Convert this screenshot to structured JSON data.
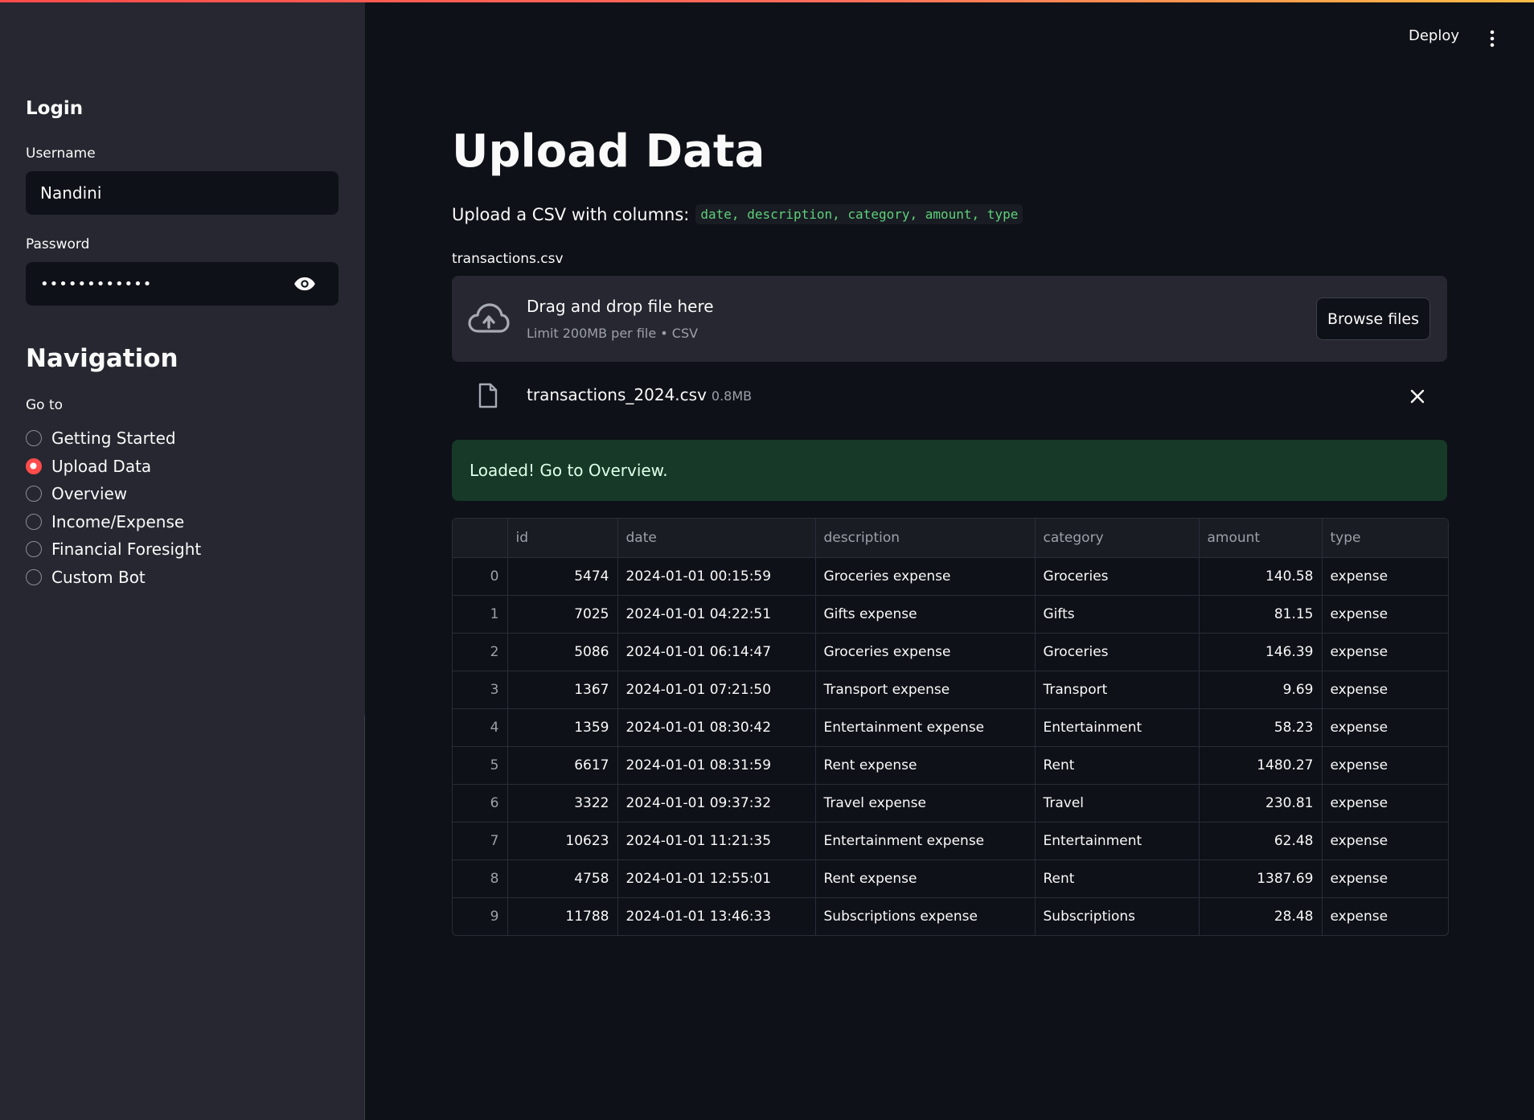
{
  "header": {
    "deploy_label": "Deploy",
    "menu_icon": "kebab-menu-icon"
  },
  "sidebar": {
    "login_title": "Login",
    "username_label": "Username",
    "username_value": "Nandini",
    "password_label": "Password",
    "password_masked": "••••••••••••",
    "nav_title": "Navigation",
    "goto_label": "Go to",
    "nav_items": [
      {
        "label": "Getting Started",
        "selected": false
      },
      {
        "label": "Upload Data",
        "selected": true
      },
      {
        "label": "Overview",
        "selected": false
      },
      {
        "label": "Income/Expense",
        "selected": false
      },
      {
        "label": "Financial Foresight",
        "selected": false
      },
      {
        "label": "Custom Bot",
        "selected": false
      }
    ]
  },
  "main": {
    "title": "Upload Data",
    "subtitle_text": "Upload a CSV with columns:",
    "subtitle_code": "date, description, category, amount, type",
    "uploader_label": "transactions.csv",
    "dropzone": {
      "title": "Drag and drop file here",
      "limit": "Limit 200MB per file • CSV",
      "browse_label": "Browse files"
    },
    "file": {
      "name": "transactions_2024.csv",
      "size": "0.8MB"
    },
    "success_message": "Loaded! Go to Overview.",
    "table": {
      "columns": [
        "",
        "id",
        "date",
        "description",
        "category",
        "amount",
        "type"
      ],
      "rows": [
        [
          "0",
          "5474",
          "2024-01-01 00:15:59",
          "Groceries expense",
          "Groceries",
          "140.58",
          "expense"
        ],
        [
          "1",
          "7025",
          "2024-01-01 04:22:51",
          "Gifts expense",
          "Gifts",
          "81.15",
          "expense"
        ],
        [
          "2",
          "5086",
          "2024-01-01 06:14:47",
          "Groceries expense",
          "Groceries",
          "146.39",
          "expense"
        ],
        [
          "3",
          "1367",
          "2024-01-01 07:21:50",
          "Transport expense",
          "Transport",
          "9.69",
          "expense"
        ],
        [
          "4",
          "1359",
          "2024-01-01 08:30:42",
          "Entertainment expense",
          "Entertainment",
          "58.23",
          "expense"
        ],
        [
          "5",
          "6617",
          "2024-01-01 08:31:59",
          "Rent expense",
          "Rent",
          "1480.27",
          "expense"
        ],
        [
          "6",
          "3322",
          "2024-01-01 09:37:32",
          "Travel expense",
          "Travel",
          "230.81",
          "expense"
        ],
        [
          "7",
          "10623",
          "2024-01-01 11:21:35",
          "Entertainment expense",
          "Entertainment",
          "62.48",
          "expense"
        ],
        [
          "8",
          "4758",
          "2024-01-01 12:55:01",
          "Rent expense",
          "Rent",
          "1387.69",
          "expense"
        ],
        [
          "9",
          "11788",
          "2024-01-01 13:46:33",
          "Subscriptions expense",
          "Subscriptions",
          "28.48",
          "expense"
        ]
      ]
    }
  },
  "colors": {
    "accent": "#ff4b4b",
    "background": "#0e1117",
    "sidebar": "#262730",
    "success_bg": "#173928",
    "code": "#5ed17a"
  }
}
